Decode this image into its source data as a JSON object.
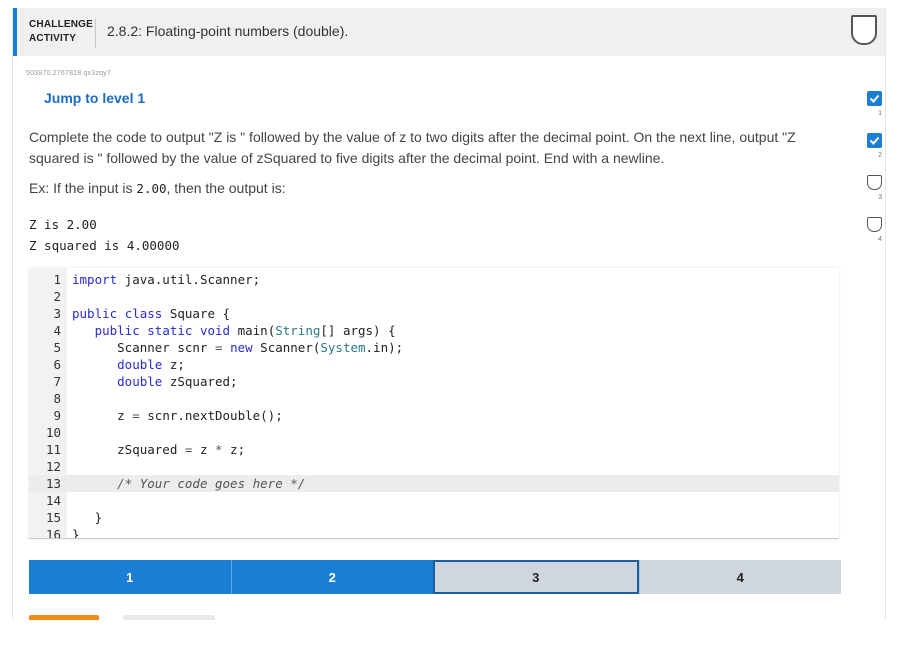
{
  "header": {
    "kind_line1": "CHALLENGE",
    "kind_line2": "ACTIVITY",
    "title": "2.8.2: Floating-point numbers (double)."
  },
  "activity_id": "503870.2767818.qx3zqy7",
  "jump_label": "Jump to level 1",
  "instructions": {
    "p1": "Complete the code to output \"Z is \" followed by the value of z to two digits after the decimal point. On the next line, output \"Z squared is \" followed by the value of zSquared to five digits after the decimal point. End with a newline.",
    "ex_prefix": "Ex: If the input is ",
    "ex_input": "2.00",
    "ex_suffix": ", then the output is:"
  },
  "expected_output": [
    "Z is 2.00",
    "Z squared is 4.00000"
  ],
  "code_lines": [
    "import java.util.Scanner;",
    "",
    "public class Square {",
    "   public static void main(String[] args) {",
    "      Scanner scnr = new Scanner(System.in);",
    "      double z;",
    "      double zSquared;",
    "",
    "      z = scnr.nextDouble();",
    "",
    "      zSquared = z * z;",
    "",
    "      /* Your code goes here */",
    "",
    "   }",
    "}"
  ],
  "highlighted_line": 13,
  "levels": [
    {
      "label": "1",
      "status": "done"
    },
    {
      "label": "2",
      "status": "done"
    },
    {
      "label": "3",
      "status": "current"
    },
    {
      "label": "4",
      "status": "todo"
    }
  ],
  "side_progress": [
    {
      "label": "1",
      "status": "done"
    },
    {
      "label": "2",
      "status": "done"
    },
    {
      "label": "3",
      "status": "todo"
    },
    {
      "label": "4",
      "status": "todo"
    }
  ],
  "colors": {
    "accent": "#1a7fd4",
    "current_border": "#1a5fa6",
    "pending": "#cfd6dd",
    "run_button": "#f28a1a"
  }
}
